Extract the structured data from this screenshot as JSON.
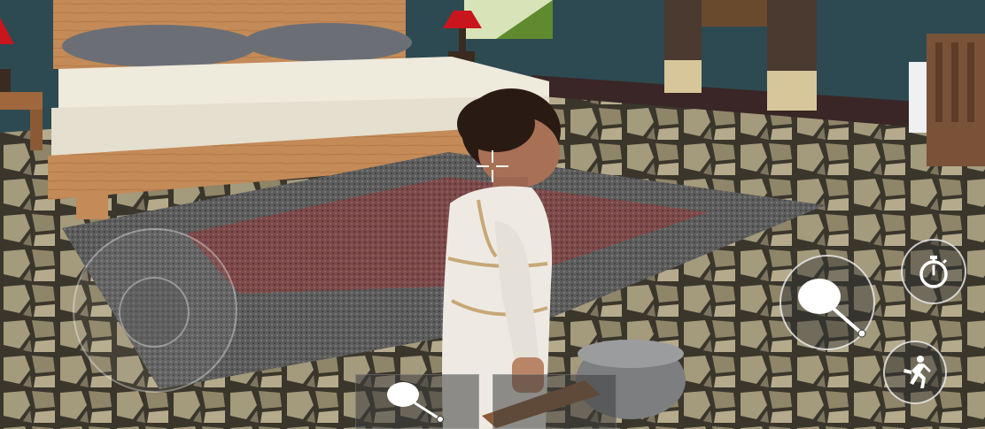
{
  "hud": {
    "joystick": {
      "name": "movement-joystick"
    },
    "actions": [
      {
        "id": "attack",
        "icon": "frying-pan-icon"
      },
      {
        "id": "timer",
        "icon": "stopwatch-icon"
      },
      {
        "id": "flee",
        "icon": "running-figure-icon"
      }
    ],
    "inventory": [
      {
        "slot": 1,
        "icon": "frying-pan-icon"
      },
      {
        "slot": 2,
        "icon": "empty-slot"
      }
    ],
    "crosshair": "crosshair-icon"
  },
  "colors": {
    "wall": "#2d4a52",
    "floor_tile": "#a49a7c",
    "bed_wood": "#c48a57",
    "rug_outer": "#5d5d5d",
    "rug_inner": "#7c4a4a",
    "lamp_shade": "#c8161c",
    "hud_white": "#ffffff"
  }
}
